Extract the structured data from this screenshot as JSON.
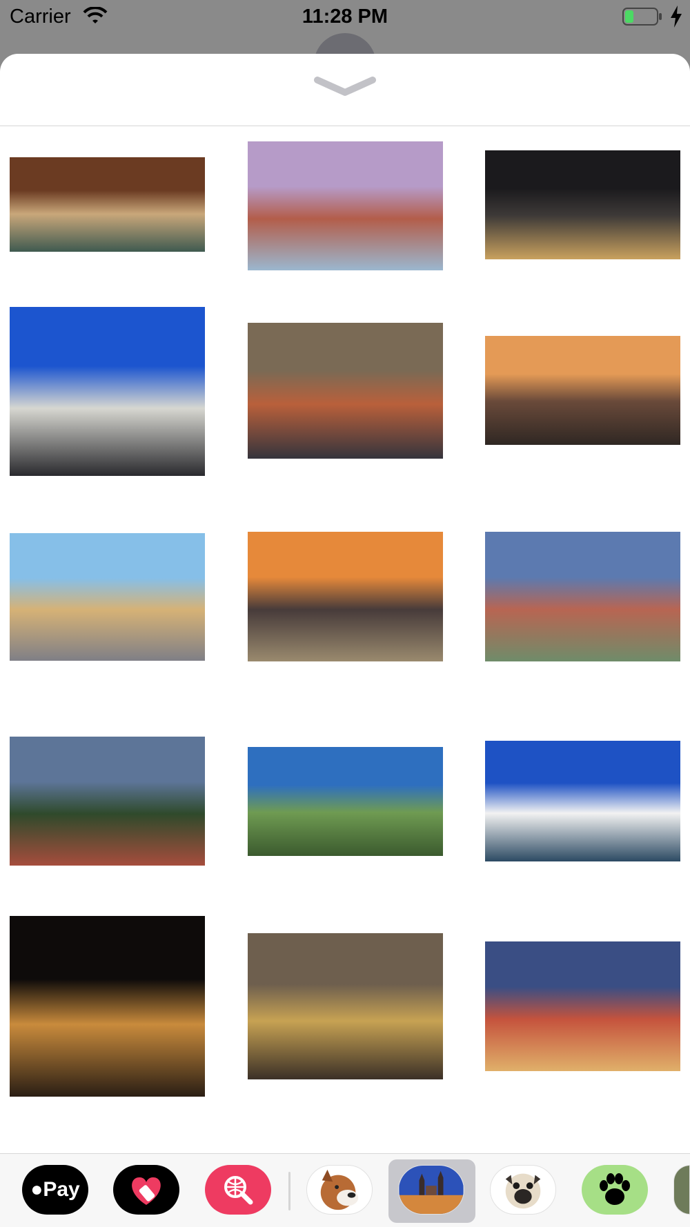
{
  "status_bar": {
    "carrier": "Carrier",
    "time": "11:28 PM",
    "battery_color": "#4cd964"
  },
  "sheet": {
    "dismiss_icon": "chevron-down-icon"
  },
  "gallery": {
    "photos": [
      {
        "name": "library",
        "colors": [
          "#6b3b22",
          "#c9a77a",
          "#3f5a50"
        ]
      },
      {
        "name": "charles-bridge-castle",
        "colors": [
          "#b69bc8",
          "#b35d4a",
          "#9bb7cf"
        ]
      },
      {
        "name": "bridge-tower-night",
        "colors": [
          "#1b1a1d",
          "#3e3a38",
          "#c9a15e"
        ]
      },
      {
        "name": "dancing-house",
        "colors": [
          "#1c55cf",
          "#d7d7d1",
          "#2a2a2e"
        ]
      },
      {
        "name": "street-shops",
        "colors": [
          "#7a6a55",
          "#b9603b",
          "#35343c"
        ]
      },
      {
        "name": "bridges-sunset",
        "colors": [
          "#e49a56",
          "#6a4a3a",
          "#2f2723"
        ]
      },
      {
        "name": "old-town-street",
        "colors": [
          "#86bfe8",
          "#d6b276",
          "#7f7f86"
        ]
      },
      {
        "name": "vltava-sunset",
        "colors": [
          "#e6893a",
          "#473b3a",
          "#9a8a6e"
        ]
      },
      {
        "name": "troja-palace",
        "colors": [
          "#5c7ab0",
          "#b86552",
          "#6f8c6a"
        ]
      },
      {
        "name": "st-lawrence-church",
        "colors": [
          "#5d7598",
          "#2f4a2b",
          "#a64d3d"
        ]
      },
      {
        "name": "river-panorama",
        "colors": [
          "#2e6fbf",
          "#6f9b52",
          "#3b5a2e"
        ]
      },
      {
        "name": "lake-clouds",
        "colors": [
          "#1e52c4",
          "#f2f2f2",
          "#2c4a63"
        ]
      },
      {
        "name": "riverside-night",
        "colors": [
          "#0e0b0a",
          "#c98b3c",
          "#2a1e14"
        ]
      },
      {
        "name": "astronomical-clock",
        "colors": [
          "#6e5f4e",
          "#c7a253",
          "#3b3027"
        ]
      },
      {
        "name": "city-lights-dusk",
        "colors": [
          "#3a4e84",
          "#c5533d",
          "#e0b06a"
        ]
      }
    ]
  },
  "drawer": {
    "apps": [
      {
        "label": "Pay",
        "icon": "apple-icon"
      },
      {
        "label": "",
        "icon": "heart-tag-icon"
      },
      {
        "label": "",
        "icon": "globe-search-icon"
      },
      {
        "label": "",
        "icon": "boxer-dog-icon"
      },
      {
        "label": "",
        "icon": "prague-icon"
      },
      {
        "label": "",
        "icon": "pug-icon"
      },
      {
        "label": "",
        "icon": "paw-icon"
      }
    ]
  }
}
